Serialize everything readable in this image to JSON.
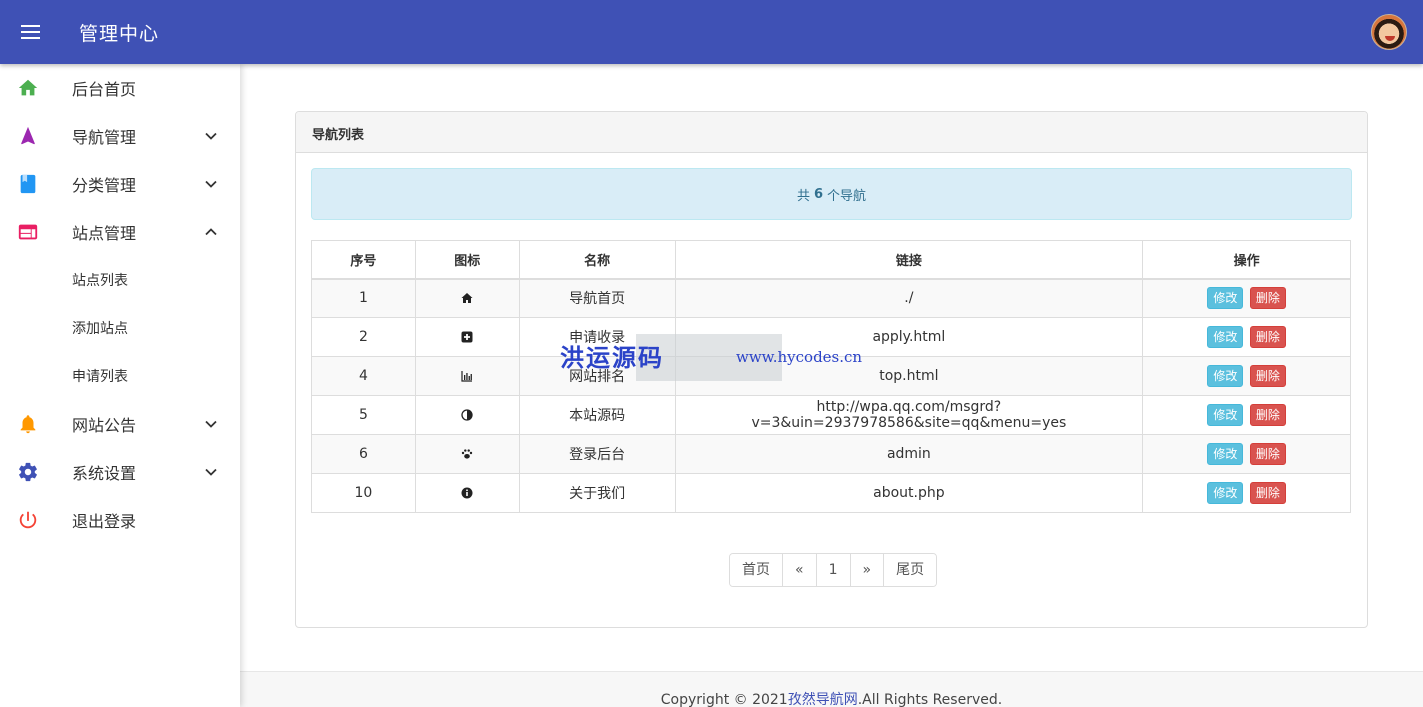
{
  "header": {
    "title": "管理中心",
    "accent": "#3f51b5"
  },
  "sidebar": {
    "items": [
      {
        "label": "后台首页",
        "icon": "home-icon"
      },
      {
        "label": "导航管理",
        "icon": "navigation-icon"
      },
      {
        "label": "分类管理",
        "icon": "book-icon"
      },
      {
        "label": "站点管理",
        "icon": "web-icon"
      },
      {
        "label": "网站公告",
        "icon": "bell-icon"
      },
      {
        "label": "系统设置",
        "icon": "gear-icon"
      },
      {
        "label": "退出登录",
        "icon": "power-icon"
      }
    ],
    "sub_items": [
      "站点列表",
      "添加站点",
      "申请列表"
    ]
  },
  "panel": {
    "title": "导航列表",
    "summary_prefix": "共",
    "summary_count": "6",
    "summary_suffix": "个导航"
  },
  "table": {
    "headers": [
      "序号",
      "图标",
      "名称",
      "链接",
      "操作"
    ],
    "rows": [
      {
        "id": "1",
        "icon": "home-icon",
        "name": "导航首页",
        "link": "./"
      },
      {
        "id": "2",
        "icon": "plus-square-icon",
        "name": "申请收录",
        "link": "apply.html"
      },
      {
        "id": "4",
        "icon": "bar-chart-icon",
        "name": "网站排名",
        "link": "top.html"
      },
      {
        "id": "5",
        "icon": "adjust-icon",
        "name": "本站源码",
        "link": "http://wpa.qq.com/msgrd?v=3&uin=2937978586&site=qq&menu=yes"
      },
      {
        "id": "6",
        "icon": "paw-icon",
        "name": "登录后台",
        "link": "admin"
      },
      {
        "id": "10",
        "icon": "info-circle-icon",
        "name": "关于我们",
        "link": "about.php"
      }
    ],
    "edit_label": "修改",
    "delete_label": "删除"
  },
  "pagination": {
    "first": "首页",
    "prev": "«",
    "current": "1",
    "next": "»",
    "last": "尾页"
  },
  "footer": {
    "prefix": "Copyright © 2021",
    "brand": "孜然导航网",
    "suffix": ".All Rights Reserved."
  },
  "watermark": {
    "text": "洪运源码",
    "url": "www.hycodes.cn"
  }
}
